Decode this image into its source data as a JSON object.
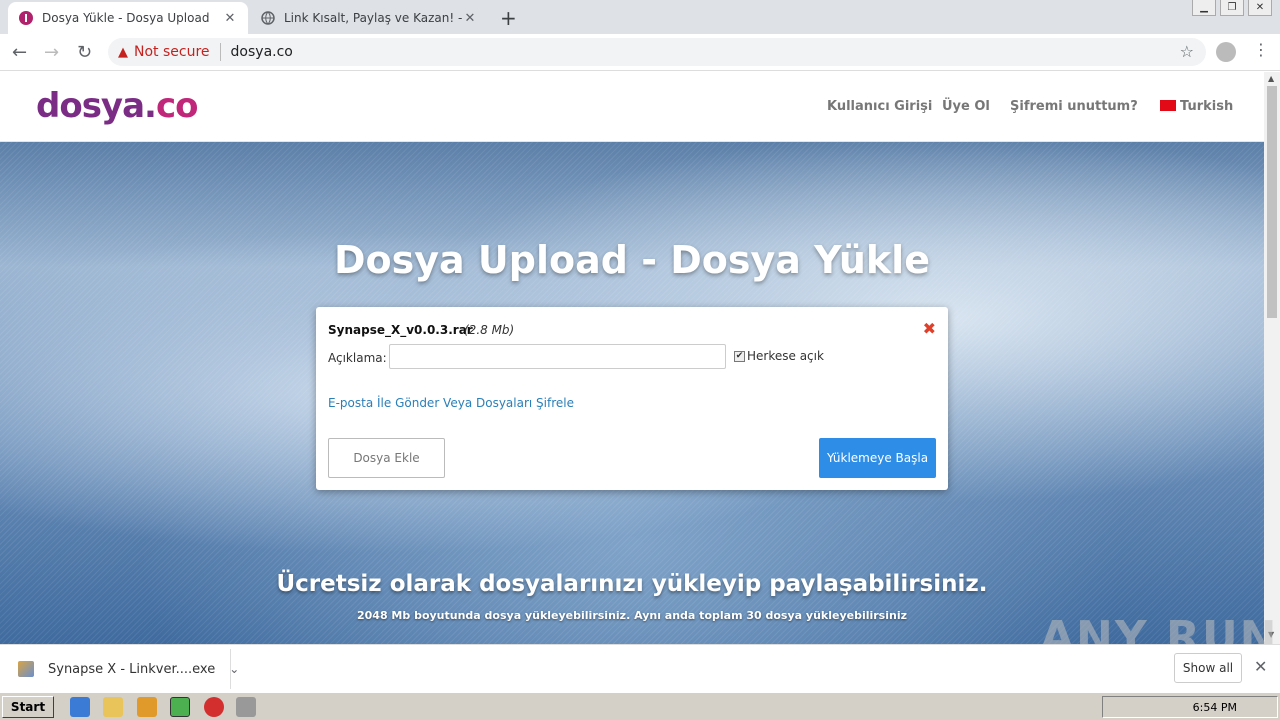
{
  "browser": {
    "tabs": [
      {
        "title": "Dosya Yükle - Dosya Upload",
        "active": true
      },
      {
        "title": "Link Kısalt, Paylaş ve Kazan! - TIK.LA",
        "active": false
      }
    ],
    "close_glyph": "✕",
    "newtab_glyph": "+",
    "security_label": "Not secure",
    "url": "dosya.co"
  },
  "site": {
    "logo_main": "dosya.",
    "logo_tld": "co",
    "nav": [
      "Kullanıcı Girişi",
      "Üye Ol",
      "Şifremi unuttum?"
    ],
    "language": "Turkish"
  },
  "hero": {
    "title": "Dosya Upload - Dosya Yükle",
    "tagline": "Ücretsiz olarak dosyalarınızı yükleyip paylaşabilirsiniz.",
    "subline": "2048 Mb boyutunda dosya yükleyebilirsiniz. Aynı anda toplam 30 dosya yükleyebilirsiniz"
  },
  "upload": {
    "filename": "Synapse_X_v0.0.3.rar",
    "filesize": "(2.8 Mb)",
    "description_label": "Açıklama:",
    "description_value": "",
    "public_label": "Herkese açık",
    "public_checked": true,
    "email_link": "E-posta İle Gönder Veya Dosyaları Şifrele",
    "add_button": "Dosya Ekle",
    "start_button": "Yüklemeye Başla"
  },
  "download_bar": {
    "item": "Synapse X - Linkver....exe",
    "show_all": "Show all"
  },
  "taskbar": {
    "start": "Start",
    "clock": "6:54 PM"
  },
  "watermark": "ANY RUN",
  "colors": {
    "logo_purple": "#7b2d86",
    "logo_pink": "#c0267a",
    "primary_button": "#2e8de6",
    "link": "#2b7fb8",
    "remove_icon": "#e0402a"
  }
}
